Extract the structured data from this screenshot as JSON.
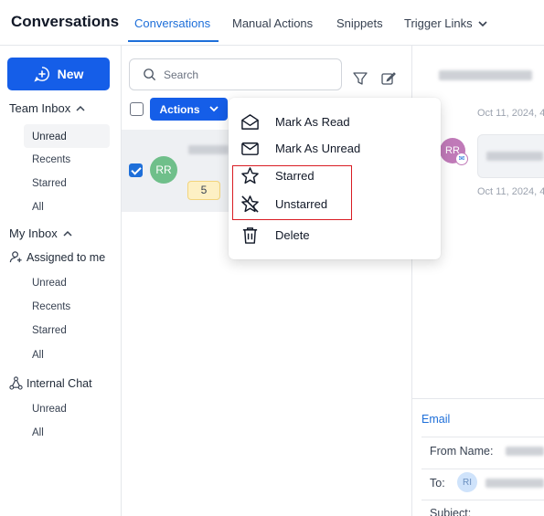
{
  "header": {
    "app_title": "Conversations",
    "tabs": [
      {
        "label": "Conversations",
        "active": true
      },
      {
        "label": "Manual Actions"
      },
      {
        "label": "Snippets"
      },
      {
        "label": "Trigger Links"
      }
    ]
  },
  "sidebar": {
    "new_label": "New",
    "team_inbox": {
      "label": "Team Inbox",
      "items": [
        "Unread",
        "Recents",
        "Starred",
        "All"
      ],
      "active": "Unread"
    },
    "my_inbox": {
      "label": "My Inbox",
      "assigned_label": "Assigned to me",
      "items": [
        "Unread",
        "Recents",
        "Starred",
        "All"
      ]
    },
    "internal_chat": {
      "label": "Internal Chat",
      "items": [
        "Unread",
        "All"
      ]
    }
  },
  "list": {
    "search_placeholder": "Search",
    "actions_label": "Actions",
    "conversation": {
      "initials": "RR",
      "count": "5"
    }
  },
  "menu": {
    "items": [
      "Mark As Read",
      "Mark As Unread",
      "Starred",
      "Unstarred",
      "Delete"
    ]
  },
  "right": {
    "timestamp_1": "Oct 11, 2024, 4",
    "timestamp_2": "Oct 11, 2024, 4",
    "avatar_initials": "RR",
    "email_tab": "Email",
    "from_label": "From Name:",
    "to_label": "To:",
    "to_avatar": "RI",
    "subject_label": "Subject:"
  },
  "colors": {
    "accent": "#155ee8",
    "highlight": "#d91c23",
    "avatar_green": "#6fbf8a",
    "avatar_purple": "#c07ab8"
  }
}
